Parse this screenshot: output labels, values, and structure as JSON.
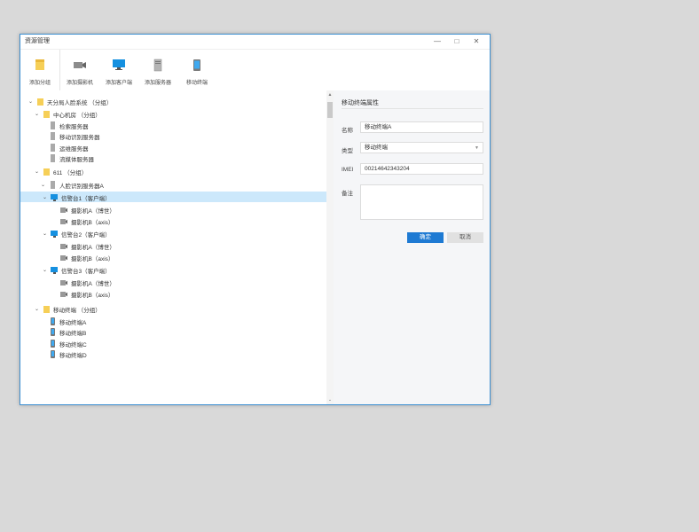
{
  "window": {
    "title": "资源管理"
  },
  "toolbar": {
    "add_group": "添加分组",
    "add_camera": "添加摄影机",
    "add_client": "添加客户端",
    "add_server": "添加服务器",
    "mobile_terminal": "移动终端"
  },
  "tree": {
    "root": "天分局人脸系统 （分组）",
    "center": "中心机房 （分组）",
    "srv_search": "检索服务器",
    "srv_mobile_recog": "移动识别服务器",
    "srv_ops": "运维服务器",
    "srv_stream": "流媒体服务器",
    "g611": "611 （分组）",
    "face_server_a": "人脸识别服务器A",
    "client1": "信警台1（客户端）",
    "client1_camA": "摄影机A（博世）",
    "client1_camB": "摄影机B（axis）",
    "client2": "信警台2（客户端）",
    "client2_camA": "摄影机A（博世）",
    "client2_camB": "摄影机B（axis）",
    "client3": "信警台3（客户端）",
    "client3_camA": "摄影机A（博世）",
    "client3_camB": "摄影机B（axis）",
    "mobile_group": "移动终端 （分组）",
    "mobile_a": "移动终端A",
    "mobile_b": "移动终端B",
    "mobile_c": "移动终端C",
    "mobile_d": "移动终端D"
  },
  "panel": {
    "title": "移动终端属性",
    "name_label": "名称",
    "name_value": "移动终端A",
    "type_label": "类型",
    "type_value": "移动终端",
    "imei_label": "IMEI",
    "imei_value": "00214642343204",
    "note_label": "备注",
    "ok_label": "确定",
    "cancel_label": "取消"
  },
  "colors": {
    "accent": "#1e7ad3",
    "selected": "#cce8fb",
    "folder": "#f6cf57"
  }
}
